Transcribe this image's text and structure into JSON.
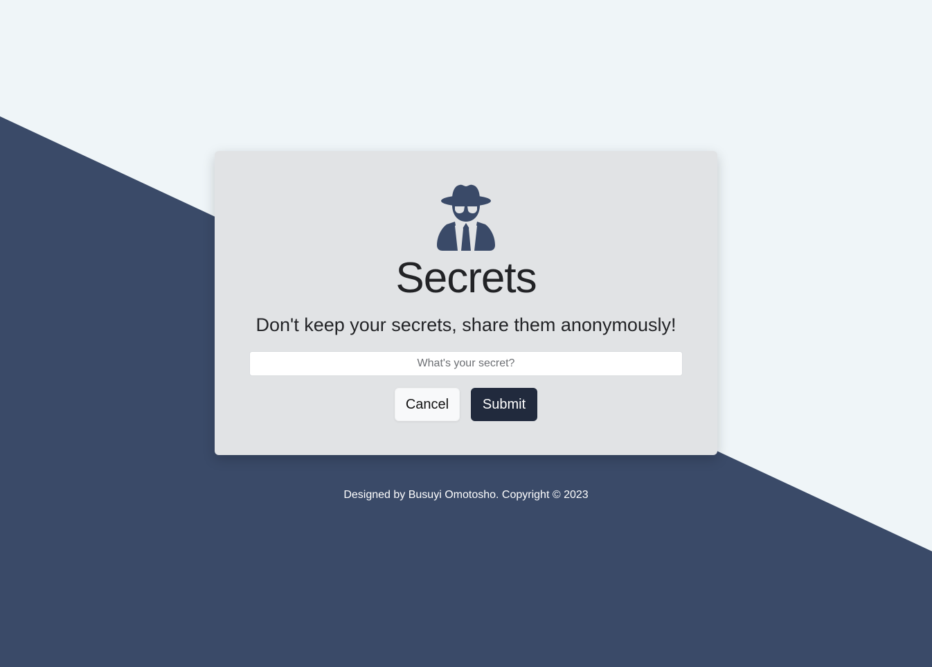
{
  "colors": {
    "page_background": "#eff5f8",
    "diagonal_band": "#3a4a68",
    "card_background": "#e1e3e5",
    "icon": "#3a4a68",
    "submit_button": "#212a3d",
    "cancel_button": "#f8f9fa",
    "text": "#222326"
  },
  "card": {
    "logo_icon": "user-secret-icon",
    "title": "Secrets",
    "subtitle": "Don't keep your secrets, share them anonymously!",
    "secret_input": {
      "placeholder": "What's your secret?",
      "value": ""
    },
    "cancel_label": "Cancel",
    "submit_label": "Submit"
  },
  "footer": {
    "text": "Designed by Busuyi Omotosho. Copyright © 2023"
  }
}
